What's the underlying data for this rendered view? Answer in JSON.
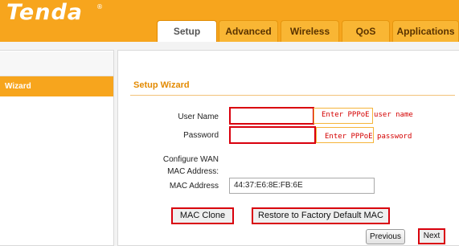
{
  "header": {
    "logo_text": "Tenda",
    "logo_mark": "®",
    "tabs": [
      {
        "label": "Setup",
        "active": true
      },
      {
        "label": "Advanced",
        "active": false
      },
      {
        "label": "Wireless",
        "active": false
      },
      {
        "label": "QoS",
        "active": false
      },
      {
        "label": "Applications",
        "active": false
      }
    ]
  },
  "sidebar": {
    "items": [
      {
        "label": "Wizard",
        "selected": true
      }
    ]
  },
  "main": {
    "section_title": "Setup Wizard",
    "user_name": {
      "label": "User Name",
      "value": "",
      "hint": "Enter PPPoE user name"
    },
    "password": {
      "label": "Password",
      "value": "",
      "hint": "Enter PPPoE password"
    },
    "configure_wan_mac_label": "Configure WAN MAC Address:",
    "mac_address": {
      "label": "MAC Address",
      "value": "44:37:E6:8E:FB:6E"
    },
    "buttons": {
      "mac_clone": "MAC Clone",
      "restore_factory_mac": "Restore to Factory Default MAC",
      "previous": "Previous",
      "next": "Next"
    }
  },
  "colors": {
    "header_orange": "#f7a51d",
    "highlight_red": "#d9000d",
    "title_orange": "#e38a00"
  }
}
